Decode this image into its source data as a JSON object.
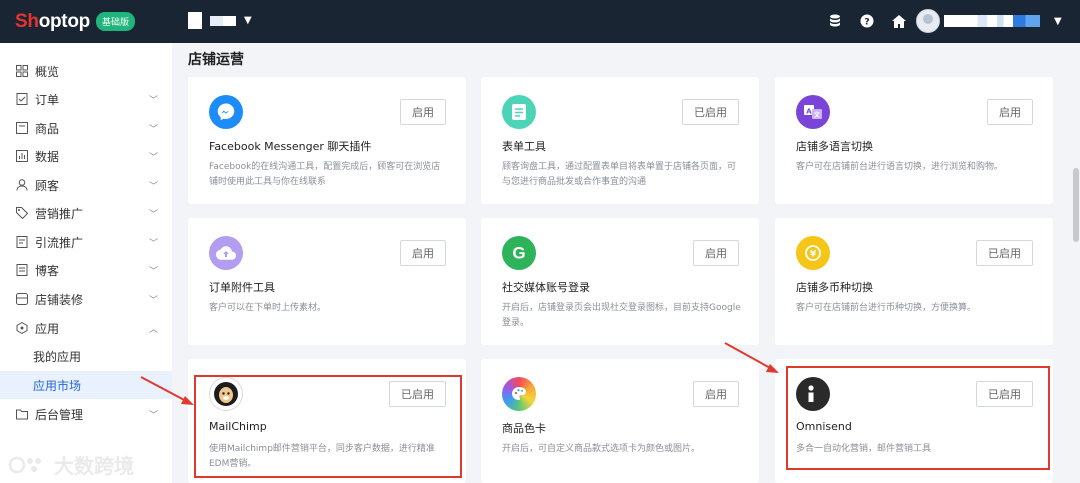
{
  "topbar": {
    "logo_part1": "Sh",
    "logo_part2": "optop",
    "plan_badge": "基础版"
  },
  "sidebar": {
    "items": [
      {
        "label": "概览",
        "icon": "overview-icon"
      },
      {
        "label": "订单",
        "icon": "order-icon"
      },
      {
        "label": "商品",
        "icon": "product-icon"
      },
      {
        "label": "数据",
        "icon": "data-icon"
      },
      {
        "label": "顾客",
        "icon": "customer-icon"
      },
      {
        "label": "营销推广",
        "icon": "tag-icon"
      },
      {
        "label": "引流推广",
        "icon": "traffic-icon"
      },
      {
        "label": "博客",
        "icon": "blog-icon"
      },
      {
        "label": "店铺装修",
        "icon": "decoration-icon"
      },
      {
        "label": "应用",
        "icon": "app-icon"
      },
      {
        "label": "我的应用"
      },
      {
        "label": "应用市场"
      },
      {
        "label": "后台管理",
        "icon": "folder-icon"
      }
    ]
  },
  "main": {
    "section_title": "店铺运营",
    "apps": [
      {
        "name": "Facebook Messenger 聊天插件",
        "desc": "Facebook的在线沟通工具，配置完成后，顾客可在浏览店铺时使用此工具与你在线联系",
        "button": "启用",
        "icon": "messenger-icon",
        "color": "#1d8cf8"
      },
      {
        "name": "表单工具",
        "desc": "顾客询盘工具，通过配置表单目将表单置于店铺各页面，可与您进行商品批发或合作事宜的沟通",
        "button": "已启用",
        "icon": "form-icon",
        "color": "#4dd4b8"
      },
      {
        "name": "店铺多语言切换",
        "desc": "客户可在店铺前台进行语言切换，进行浏览和购物。",
        "button": "启用",
        "icon": "language-icon",
        "color": "#7b44d8"
      },
      {
        "name": "订单附件工具",
        "desc": "客户可以在下单时上传素材。",
        "button": "启用",
        "icon": "upload-cloud-icon",
        "color": "#b39df0"
      },
      {
        "name": "社交媒体账号登录",
        "desc": "开启后，店铺登录页会出现社交登录图标，目前支持Google登录。",
        "button": "启用",
        "icon": "google-icon",
        "color": "#2fb35a"
      },
      {
        "name": "店铺多币种切换",
        "desc": "客户可在店铺前台进行币种切换，方便换算。",
        "button": "已启用",
        "icon": "currency-icon",
        "color": "#f5c518"
      },
      {
        "name": "MailChimp",
        "desc": "使用Mailchimp邮件营销平台，同步客户数据，进行精准EDM营销。",
        "button": "已启用",
        "icon": "mailchimp-icon",
        "color": "#ffffff"
      },
      {
        "name": "商品色卡",
        "desc": "开启后，可自定义商品款式选项卡为颜色或图片。",
        "button": "启用",
        "icon": "palette-icon",
        "color": "#f08c3a"
      },
      {
        "name": "Omnisend",
        "desc": "多合一自动化营销，邮件营销工具",
        "button": "已启用",
        "icon": "omnisend-icon",
        "color": "#2a2a2a"
      }
    ]
  },
  "watermark": {
    "text": "大数跨境"
  }
}
